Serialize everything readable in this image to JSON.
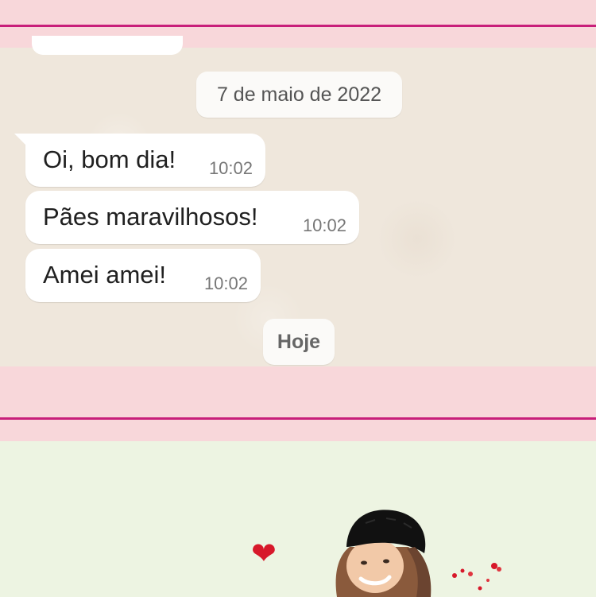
{
  "chat": {
    "date_separator": "7 de maio de 2022",
    "messages": [
      {
        "text": "Oi, bom dia!",
        "time": "10:02"
      },
      {
        "text": "Pães maravilhosos!",
        "time": "10:02"
      },
      {
        "text": "Amei amei!",
        "time": "10:02"
      }
    ],
    "today_separator": "Hoje"
  },
  "colors": {
    "frame_pink": "#f8d7da",
    "line_magenta": "#c81f7a",
    "chat_background": "#efe7dc",
    "bubble": "#ffffff",
    "sticker_background": "#edf4e2",
    "heart": "#d7182a"
  },
  "stickers": {
    "heart_icon": "heart-icon",
    "person_image": "person-photo-sticker",
    "sparkle_icon": "hearts-sparkle-icon"
  }
}
